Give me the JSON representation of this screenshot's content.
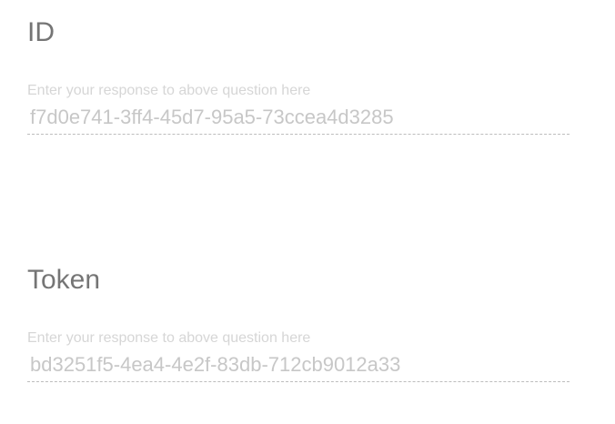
{
  "questions": [
    {
      "label": "ID",
      "hint": "Enter your response to above question here",
      "value": "f7d0e741-3ff4-45d7-95a5-73ccea4d3285"
    },
    {
      "label": "Token",
      "hint": "Enter your response to above question here",
      "value": "bd3251f5-4ea4-4e2f-83db-712cb9012a33"
    }
  ]
}
